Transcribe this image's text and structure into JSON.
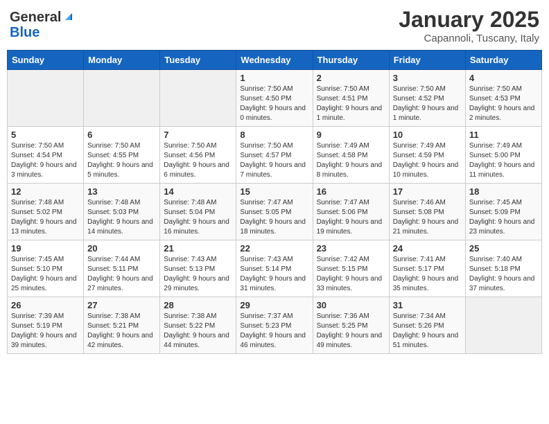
{
  "header": {
    "logo_general": "General",
    "logo_blue": "Blue",
    "title": "January 2025",
    "subtitle": "Capannoli, Tuscany, Italy"
  },
  "days_of_week": [
    "Sunday",
    "Monday",
    "Tuesday",
    "Wednesday",
    "Thursday",
    "Friday",
    "Saturday"
  ],
  "weeks": [
    [
      {
        "day": "",
        "sunrise": "",
        "sunset": "",
        "daylight": "",
        "empty": true
      },
      {
        "day": "",
        "sunrise": "",
        "sunset": "",
        "daylight": "",
        "empty": true
      },
      {
        "day": "",
        "sunrise": "",
        "sunset": "",
        "daylight": "",
        "empty": true
      },
      {
        "day": "1",
        "sunrise": "Sunrise: 7:50 AM",
        "sunset": "Sunset: 4:50 PM",
        "daylight": "Daylight: 9 hours and 0 minutes."
      },
      {
        "day": "2",
        "sunrise": "Sunrise: 7:50 AM",
        "sunset": "Sunset: 4:51 PM",
        "daylight": "Daylight: 9 hours and 1 minute."
      },
      {
        "day": "3",
        "sunrise": "Sunrise: 7:50 AM",
        "sunset": "Sunset: 4:52 PM",
        "daylight": "Daylight: 9 hours and 1 minute."
      },
      {
        "day": "4",
        "sunrise": "Sunrise: 7:50 AM",
        "sunset": "Sunset: 4:53 PM",
        "daylight": "Daylight: 9 hours and 2 minutes."
      }
    ],
    [
      {
        "day": "5",
        "sunrise": "Sunrise: 7:50 AM",
        "sunset": "Sunset: 4:54 PM",
        "daylight": "Daylight: 9 hours and 3 minutes."
      },
      {
        "day": "6",
        "sunrise": "Sunrise: 7:50 AM",
        "sunset": "Sunset: 4:55 PM",
        "daylight": "Daylight: 9 hours and 5 minutes."
      },
      {
        "day": "7",
        "sunrise": "Sunrise: 7:50 AM",
        "sunset": "Sunset: 4:56 PM",
        "daylight": "Daylight: 9 hours and 6 minutes."
      },
      {
        "day": "8",
        "sunrise": "Sunrise: 7:50 AM",
        "sunset": "Sunset: 4:57 PM",
        "daylight": "Daylight: 9 hours and 7 minutes."
      },
      {
        "day": "9",
        "sunrise": "Sunrise: 7:49 AM",
        "sunset": "Sunset: 4:58 PM",
        "daylight": "Daylight: 9 hours and 8 minutes."
      },
      {
        "day": "10",
        "sunrise": "Sunrise: 7:49 AM",
        "sunset": "Sunset: 4:59 PM",
        "daylight": "Daylight: 9 hours and 10 minutes."
      },
      {
        "day": "11",
        "sunrise": "Sunrise: 7:49 AM",
        "sunset": "Sunset: 5:00 PM",
        "daylight": "Daylight: 9 hours and 11 minutes."
      }
    ],
    [
      {
        "day": "12",
        "sunrise": "Sunrise: 7:48 AM",
        "sunset": "Sunset: 5:02 PM",
        "daylight": "Daylight: 9 hours and 13 minutes."
      },
      {
        "day": "13",
        "sunrise": "Sunrise: 7:48 AM",
        "sunset": "Sunset: 5:03 PM",
        "daylight": "Daylight: 9 hours and 14 minutes."
      },
      {
        "day": "14",
        "sunrise": "Sunrise: 7:48 AM",
        "sunset": "Sunset: 5:04 PM",
        "daylight": "Daylight: 9 hours and 16 minutes."
      },
      {
        "day": "15",
        "sunrise": "Sunrise: 7:47 AM",
        "sunset": "Sunset: 5:05 PM",
        "daylight": "Daylight: 9 hours and 18 minutes."
      },
      {
        "day": "16",
        "sunrise": "Sunrise: 7:47 AM",
        "sunset": "Sunset: 5:06 PM",
        "daylight": "Daylight: 9 hours and 19 minutes."
      },
      {
        "day": "17",
        "sunrise": "Sunrise: 7:46 AM",
        "sunset": "Sunset: 5:08 PM",
        "daylight": "Daylight: 9 hours and 21 minutes."
      },
      {
        "day": "18",
        "sunrise": "Sunrise: 7:45 AM",
        "sunset": "Sunset: 5:09 PM",
        "daylight": "Daylight: 9 hours and 23 minutes."
      }
    ],
    [
      {
        "day": "19",
        "sunrise": "Sunrise: 7:45 AM",
        "sunset": "Sunset: 5:10 PM",
        "daylight": "Daylight: 9 hours and 25 minutes."
      },
      {
        "day": "20",
        "sunrise": "Sunrise: 7:44 AM",
        "sunset": "Sunset: 5:11 PM",
        "daylight": "Daylight: 9 hours and 27 minutes."
      },
      {
        "day": "21",
        "sunrise": "Sunrise: 7:43 AM",
        "sunset": "Sunset: 5:13 PM",
        "daylight": "Daylight: 9 hours and 29 minutes."
      },
      {
        "day": "22",
        "sunrise": "Sunrise: 7:43 AM",
        "sunset": "Sunset: 5:14 PM",
        "daylight": "Daylight: 9 hours and 31 minutes."
      },
      {
        "day": "23",
        "sunrise": "Sunrise: 7:42 AM",
        "sunset": "Sunset: 5:15 PM",
        "daylight": "Daylight: 9 hours and 33 minutes."
      },
      {
        "day": "24",
        "sunrise": "Sunrise: 7:41 AM",
        "sunset": "Sunset: 5:17 PM",
        "daylight": "Daylight: 9 hours and 35 minutes."
      },
      {
        "day": "25",
        "sunrise": "Sunrise: 7:40 AM",
        "sunset": "Sunset: 5:18 PM",
        "daylight": "Daylight: 9 hours and 37 minutes."
      }
    ],
    [
      {
        "day": "26",
        "sunrise": "Sunrise: 7:39 AM",
        "sunset": "Sunset: 5:19 PM",
        "daylight": "Daylight: 9 hours and 39 minutes."
      },
      {
        "day": "27",
        "sunrise": "Sunrise: 7:38 AM",
        "sunset": "Sunset: 5:21 PM",
        "daylight": "Daylight: 9 hours and 42 minutes."
      },
      {
        "day": "28",
        "sunrise": "Sunrise: 7:38 AM",
        "sunset": "Sunset: 5:22 PM",
        "daylight": "Daylight: 9 hours and 44 minutes."
      },
      {
        "day": "29",
        "sunrise": "Sunrise: 7:37 AM",
        "sunset": "Sunset: 5:23 PM",
        "daylight": "Daylight: 9 hours and 46 minutes."
      },
      {
        "day": "30",
        "sunrise": "Sunrise: 7:36 AM",
        "sunset": "Sunset: 5:25 PM",
        "daylight": "Daylight: 9 hours and 49 minutes."
      },
      {
        "day": "31",
        "sunrise": "Sunrise: 7:34 AM",
        "sunset": "Sunset: 5:26 PM",
        "daylight": "Daylight: 9 hours and 51 minutes."
      },
      {
        "day": "",
        "sunrise": "",
        "sunset": "",
        "daylight": "",
        "empty": true
      }
    ]
  ]
}
